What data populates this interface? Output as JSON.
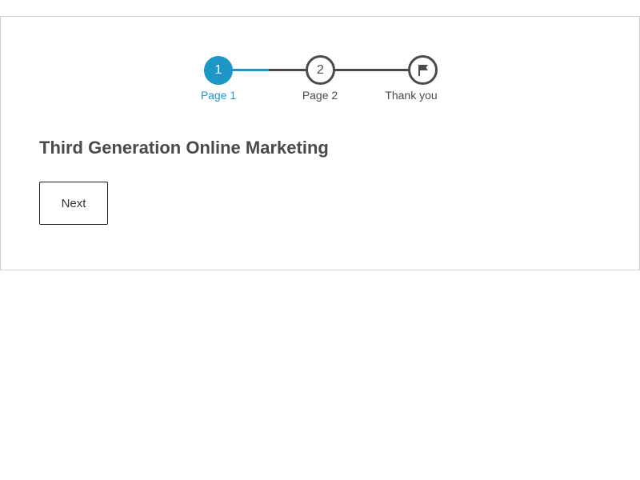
{
  "stepper": {
    "steps": [
      {
        "number": "1",
        "label": "Page 1",
        "state": "active"
      },
      {
        "number": "2",
        "label": "Page 2",
        "state": "upcoming"
      },
      {
        "icon": "flag-icon",
        "label": "Thank you",
        "state": "upcoming"
      }
    ],
    "progress": 0.25
  },
  "page": {
    "title": "Third Generation Online Marketing"
  },
  "actions": {
    "next_label": "Next"
  },
  "colors": {
    "accent": "#1d96c8",
    "text": "#4a4a4a",
    "border": "#cfcfcf"
  }
}
